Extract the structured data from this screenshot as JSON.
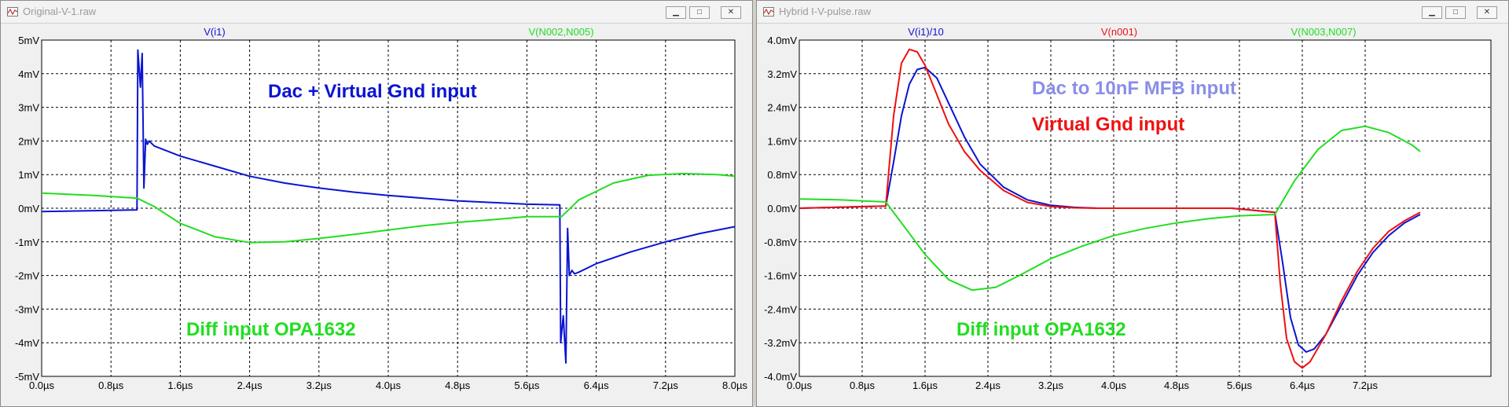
{
  "colors": {
    "blue": "#0a14d2",
    "green": "#22dd22",
    "red": "#ee1111",
    "lavender": "#8a8ee8"
  },
  "windows": [
    {
      "title": "Original-V-1.raw",
      "icon": "ltspice-waveform-icon",
      "controls": {
        "minimize": "▁",
        "maximize": "□",
        "close": "✕"
      }
    },
    {
      "title": "Hybrid I-V-pulse.raw",
      "icon": "ltspice-waveform-icon",
      "controls": {
        "minimize": "▁",
        "maximize": "□",
        "close": "✕"
      }
    }
  ],
  "chart_data": [
    {
      "type": "line",
      "grid": true,
      "xlim": [
        0,
        8
      ],
      "ylim": [
        -5,
        5
      ],
      "x_ticks": [
        "0.0µs",
        "0.8µs",
        "1.6µs",
        "2.4µs",
        "3.2µs",
        "4.0µs",
        "4.8µs",
        "5.6µs",
        "6.4µs",
        "7.2µs",
        "8.0µs"
      ],
      "y_ticks": [
        "5mV",
        "4mV",
        "3mV",
        "2mV",
        "1mV",
        "0mV",
        "-1mV",
        "-2mV",
        "-3mV",
        "-4mV",
        "-5mV"
      ],
      "annotations": [
        {
          "text": "Dac + Virtual Gnd input",
          "color": "#0a14d2"
        },
        {
          "text": "Diff input OPA1632",
          "color": "#22dd22"
        }
      ],
      "series": [
        {
          "name": "V(i1)",
          "color": "#0a14d2",
          "x": [
            0,
            1.1,
            1.11,
            1.14,
            1.16,
            1.18,
            1.2,
            1.22,
            1.24,
            1.3,
            1.6,
            2.0,
            2.4,
            2.8,
            3.2,
            3.6,
            4.0,
            4.4,
            4.8,
            5.2,
            5.6,
            5.98,
            5.99,
            6.02,
            6.05,
            6.07,
            6.09,
            6.12,
            6.15,
            6.2,
            6.4,
            6.8,
            7.2,
            7.6,
            8.0
          ],
          "y": [
            -0.1,
            -0.05,
            4.7,
            3.6,
            4.6,
            0.6,
            2.05,
            1.9,
            2.0,
            1.85,
            1.55,
            1.25,
            0.95,
            0.75,
            0.6,
            0.48,
            0.38,
            0.3,
            0.22,
            0.17,
            0.12,
            0.1,
            -4.0,
            -3.2,
            -4.6,
            -0.6,
            -2.0,
            -1.85,
            -1.95,
            -1.9,
            -1.65,
            -1.3,
            -1.0,
            -0.75,
            -0.55
          ]
        },
        {
          "name": "V(N002,N005)",
          "color": "#22dd22",
          "x": [
            0,
            0.6,
            1.1,
            1.3,
            1.6,
            2.0,
            2.4,
            2.8,
            3.2,
            3.6,
            4.0,
            4.4,
            4.8,
            5.2,
            5.6,
            6.0,
            6.2,
            6.6,
            7.0,
            7.4,
            7.8,
            8.0
          ],
          "y": [
            0.45,
            0.38,
            0.3,
            0.05,
            -0.45,
            -0.85,
            -1.02,
            -1.0,
            -0.9,
            -0.78,
            -0.65,
            -0.52,
            -0.42,
            -0.34,
            -0.25,
            -0.25,
            0.25,
            0.75,
            0.98,
            1.03,
            1.0,
            0.95
          ]
        }
      ]
    },
    {
      "type": "line",
      "grid": true,
      "xlim": [
        0,
        8
      ],
      "ylim": [
        -4.0,
        4.0
      ],
      "x_ticks": [
        "0.0µs",
        "0.8µs",
        "1.6µs",
        "2.4µs",
        "3.2µs",
        "4.0µs",
        "4.8µs",
        "5.6µs",
        "6.4µs",
        "7.2µs"
      ],
      "y_ticks": [
        "4.0mV",
        "3.2mV",
        "2.4mV",
        "1.6mV",
        "0.8mV",
        "0.0mV",
        "-0.8mV",
        "-1.6mV",
        "-2.4mV",
        "-3.2mV",
        "-4.0mV"
      ],
      "annotations": [
        {
          "text": "Dac to 10nF MFB input",
          "color": "#8a8ee8"
        },
        {
          "text": "Virtual Gnd input",
          "color": "#ee1111"
        },
        {
          "text": "Diff input OPA1632",
          "color": "#22dd22"
        }
      ],
      "series": [
        {
          "name": "V(i1)/10",
          "color": "#0a14d2",
          "x": [
            0,
            1.1,
            1.2,
            1.3,
            1.4,
            1.5,
            1.6,
            1.75,
            1.9,
            2.1,
            2.3,
            2.6,
            2.9,
            3.2,
            3.5,
            3.8,
            4.5,
            5.5,
            6.05,
            6.15,
            6.25,
            6.35,
            6.45,
            6.55,
            6.7,
            6.9,
            7.1,
            7.3,
            7.5,
            7.7,
            7.9
          ],
          "y": [
            0,
            0.05,
            1.1,
            2.2,
            2.95,
            3.3,
            3.35,
            3.1,
            2.5,
            1.7,
            1.05,
            0.5,
            0.2,
            0.07,
            0.02,
            0,
            0,
            0,
            -0.1,
            -1.3,
            -2.6,
            -3.25,
            -3.42,
            -3.35,
            -3.0,
            -2.3,
            -1.6,
            -1.05,
            -0.65,
            -0.35,
            -0.15
          ]
        },
        {
          "name": "V(n001)",
          "color": "#ee1111",
          "x": [
            0,
            1.1,
            1.2,
            1.3,
            1.4,
            1.5,
            1.6,
            1.75,
            1.9,
            2.1,
            2.3,
            2.6,
            2.9,
            3.2,
            3.5,
            3.8,
            4.5,
            5.5,
            6.05,
            6.12,
            6.2,
            6.3,
            6.4,
            6.5,
            6.7,
            6.9,
            7.1,
            7.3,
            7.5,
            7.7,
            7.9
          ],
          "y": [
            0,
            0.05,
            2.2,
            3.45,
            3.78,
            3.72,
            3.4,
            2.7,
            2.0,
            1.35,
            0.9,
            0.42,
            0.14,
            0.04,
            0.01,
            0,
            0,
            0,
            -0.1,
            -1.8,
            -3.1,
            -3.65,
            -3.8,
            -3.65,
            -3.0,
            -2.2,
            -1.5,
            -0.95,
            -0.55,
            -0.3,
            -0.1
          ]
        },
        {
          "name": "V(N003,N007)",
          "color": "#22dd22",
          "x": [
            0,
            0.5,
            1.1,
            1.3,
            1.6,
            1.9,
            2.2,
            2.5,
            2.8,
            3.2,
            3.6,
            4.0,
            4.4,
            4.8,
            5.2,
            5.6,
            6.05,
            6.3,
            6.6,
            6.9,
            7.2,
            7.5,
            7.8,
            7.9
          ],
          "y": [
            0.22,
            0.2,
            0.15,
            -0.35,
            -1.1,
            -1.7,
            -1.95,
            -1.88,
            -1.6,
            -1.2,
            -0.9,
            -0.65,
            -0.48,
            -0.35,
            -0.25,
            -0.18,
            -0.15,
            0.65,
            1.4,
            1.85,
            1.95,
            1.8,
            1.5,
            1.35
          ]
        }
      ]
    }
  ]
}
